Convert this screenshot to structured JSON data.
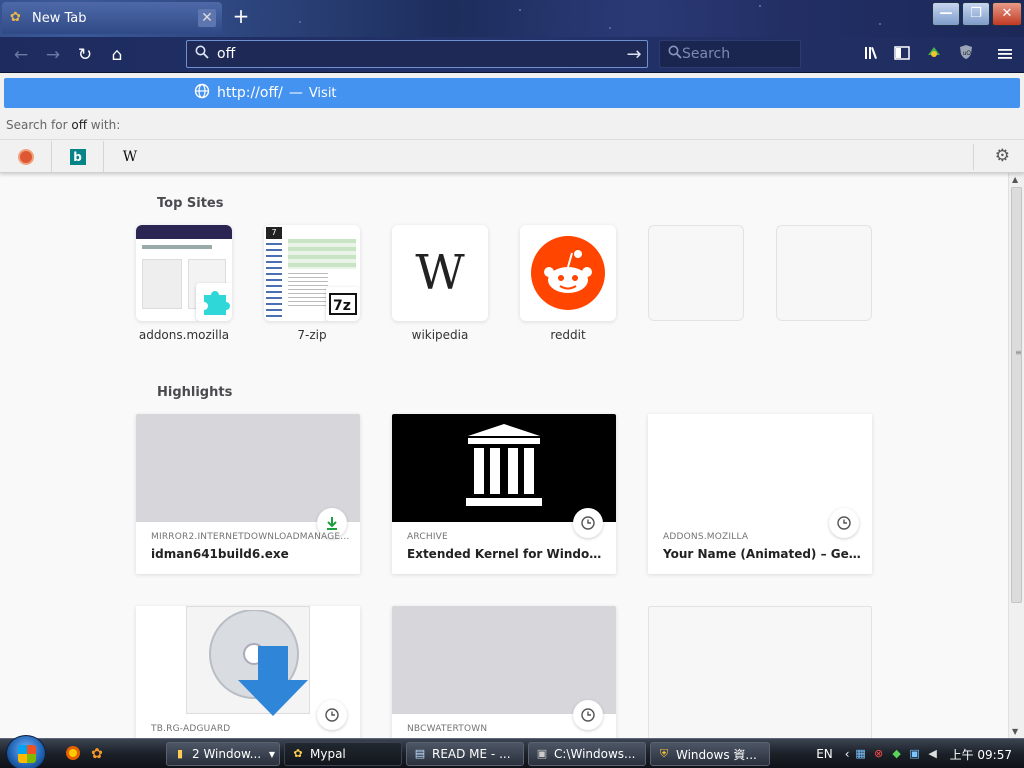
{
  "tab": {
    "title": "New Tab",
    "close_glyph": "✕"
  },
  "new_tab_glyph": "+",
  "window_buttons": {
    "minimize": "—",
    "maximize": "❐",
    "close": "✕"
  },
  "nav": {
    "back": "←",
    "forward": "→",
    "reload": "↻",
    "home": "⌂"
  },
  "urlbar": {
    "value": "off",
    "go_glyph": "→"
  },
  "searchbar": {
    "placeholder": "Search"
  },
  "toolbar_icons": [
    "library-icon",
    "sidebar-icon",
    "extension-icon",
    "ublock-icon",
    "menu-icon"
  ],
  "suggestion": {
    "url": "http://off/",
    "separator": "—",
    "action": "Visit"
  },
  "search_for": {
    "prefix": "Search for ",
    "term": "off",
    "suffix": " with:"
  },
  "engines": [
    {
      "name": "duckduckgo",
      "glyph": ""
    },
    {
      "name": "bing",
      "glyph": "b"
    },
    {
      "name": "wikipedia",
      "glyph": "W"
    }
  ],
  "top_sites": {
    "heading": "Top Sites",
    "items": [
      {
        "label": "addons.mozilla"
      },
      {
        "label": "7-zip"
      },
      {
        "label": "wikipedia"
      },
      {
        "label": "reddit"
      },
      {
        "label": ""
      },
      {
        "label": ""
      }
    ]
  },
  "highlights": {
    "heading": "Highlights",
    "cards": [
      {
        "source": "MIRROR2.INTERNETDOWNLOADMANAGE...",
        "title": "idman641build6.exe",
        "badge": "download-icon"
      },
      {
        "source": "ARCHIVE",
        "title": "Extended Kernel for Windows Vi...",
        "badge": "clock-icon"
      },
      {
        "source": "ADDONS.MOZILLA",
        "title": "Your Name (Animated) – Get thi...",
        "badge": "clock-icon"
      },
      {
        "source": "TB.RG-ADGUARD",
        "title": "",
        "badge": "clock-icon"
      },
      {
        "source": "NBCWATERTOWN",
        "title": "",
        "badge": "clock-icon"
      },
      {
        "source": "",
        "title": "",
        "badge": ""
      }
    ]
  },
  "taskbar": {
    "tasks": [
      {
        "label": "2 Window..."
      },
      {
        "label": "Mypal"
      },
      {
        "label": "READ ME - ..."
      },
      {
        "label": "C:\\Windows..."
      },
      {
        "label": "Windows 資..."
      }
    ],
    "lang": "EN",
    "clock": "上午 09:57"
  },
  "colors": {
    "accent": "#4593f0",
    "title_bar": "#1f2d63",
    "content_bg": "#f9f9fa"
  }
}
